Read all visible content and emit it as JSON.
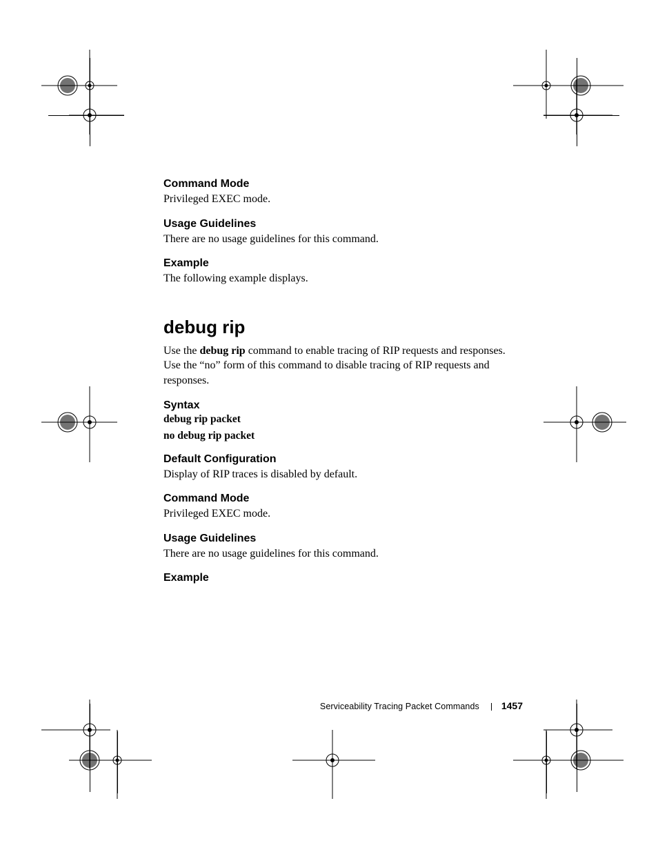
{
  "sections": {
    "s1": {
      "heading": "Command Mode",
      "text": "Privileged EXEC mode."
    },
    "s2": {
      "heading": "Usage Guidelines",
      "text": "There are no usage guidelines for this command."
    },
    "s3": {
      "heading": "Example",
      "text": "The following example displays."
    }
  },
  "command": {
    "title": "debug rip",
    "intro_pre": "Use the ",
    "intro_bold": "debug rip",
    "intro_post": " command to enable tracing of RIP requests and responses. Use the “no” form of this command to disable tracing of RIP requests and responses.",
    "syntax": {
      "heading": "Syntax",
      "line1": "debug rip packet",
      "line2": "no debug rip packet"
    },
    "default": {
      "heading": "Default Configuration",
      "text": "Display of RIP traces is disabled by default."
    },
    "mode": {
      "heading": "Command Mode",
      "text": "Privileged EXEC mode."
    },
    "usage": {
      "heading": "Usage Guidelines",
      "text": "There are no usage guidelines for this command."
    },
    "example": {
      "heading": "Example"
    }
  },
  "footer": {
    "title": "Serviceability Tracing Packet Commands",
    "page": "1457"
  }
}
